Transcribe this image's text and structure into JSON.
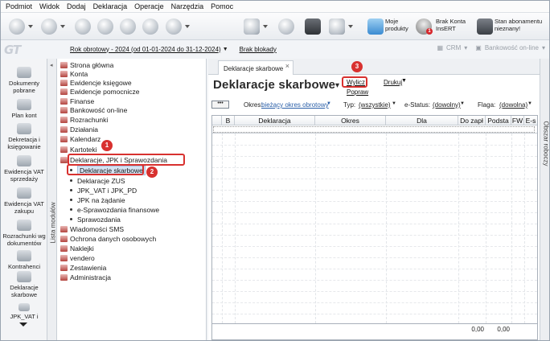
{
  "menu": [
    "Podmiot",
    "Widok",
    "Dodaj",
    "Deklaracja",
    "Operacje",
    "Narzędzia",
    "Pomoc"
  ],
  "toolbar": {
    "moje_produkty": "Moje\nprodukty",
    "brak_konta": "Brak Konta\nInsERT",
    "stan_abonamentu": "Stan abonamentu\nnieznany!",
    "notification_count": "1"
  },
  "yearbar": {
    "rok": "Rok obrotowy - 2024  (od 01-01-2024 do 31-12-2024)",
    "brak_blokady": "Brak blokady",
    "crm": "CRM",
    "bank": "Bankowość on-line"
  },
  "modules": [
    {
      "label": "Dokumenty\npobrane"
    },
    {
      "label": "Plan kont"
    },
    {
      "label": "Dekretacja i\nksięgowanie"
    },
    {
      "label": "Ewidencja VAT\nsprzedaży"
    },
    {
      "label": "Ewidencja VAT\nzakupu"
    },
    {
      "label": "Rozrachunki wg\ndokumentów"
    },
    {
      "label": "Kontrahenci"
    },
    {
      "label": "Deklaracje\nskarbowe"
    },
    {
      "label": "JPK_VAT i"
    }
  ],
  "lista_modulow": "Lista modułów",
  "obszar_roboczy": "Obszar roboczy",
  "tree": [
    {
      "label": "Strona główna"
    },
    {
      "label": "Konta"
    },
    {
      "label": "Ewidencje księgowe"
    },
    {
      "label": "Ewidencje pomocnicze"
    },
    {
      "label": "Finanse"
    },
    {
      "label": "Bankowość on-line"
    },
    {
      "label": "Rozrachunki"
    },
    {
      "label": "Działania"
    },
    {
      "label": "Kalendarz"
    },
    {
      "label": "Kartoteki"
    },
    {
      "label": "Deklaracje, JPK i Sprawozdania"
    },
    {
      "label": "Deklaracje skarbowe"
    },
    {
      "label": "Deklaracje ZUS"
    },
    {
      "label": "JPK_VAT i JPK_PD"
    },
    {
      "label": "JPK na żądanie"
    },
    {
      "label": "e-Sprawozdania finansowe"
    },
    {
      "label": "Sprawozdania"
    },
    {
      "label": "Wiadomości SMS"
    },
    {
      "label": "Ochrona danych osobowych"
    },
    {
      "label": "Naklejki"
    },
    {
      "label": "vendero"
    },
    {
      "label": "Zestawienia"
    },
    {
      "label": "Administracja"
    }
  ],
  "badges": [
    "1",
    "2",
    "3"
  ],
  "content": {
    "tab_title": "Deklaracje skarbowe",
    "page_title": "Deklaracje skarbowe",
    "wylicz": "Wylicz",
    "popraw": "Popraw",
    "drukuj": "Drukuj",
    "dots": "•••",
    "okres_label": "Okres:",
    "okres_value": "bieżący okres obrotowy",
    "typ_label": "Typ:",
    "typ_value": "(wszystkie)",
    "estatus_label": "e-Status:",
    "estatus_value": "(dowolny)",
    "flaga_label": "Flaga:",
    "flaga_value": "(dowolna)",
    "columns": [
      "B",
      "Deklaracja",
      "Okres",
      "Dla",
      "Do zapł",
      "Podsta",
      "FW",
      "E-s"
    ],
    "sum_do_zaplaty": "0,00",
    "sum_podstawa": "0,00"
  }
}
